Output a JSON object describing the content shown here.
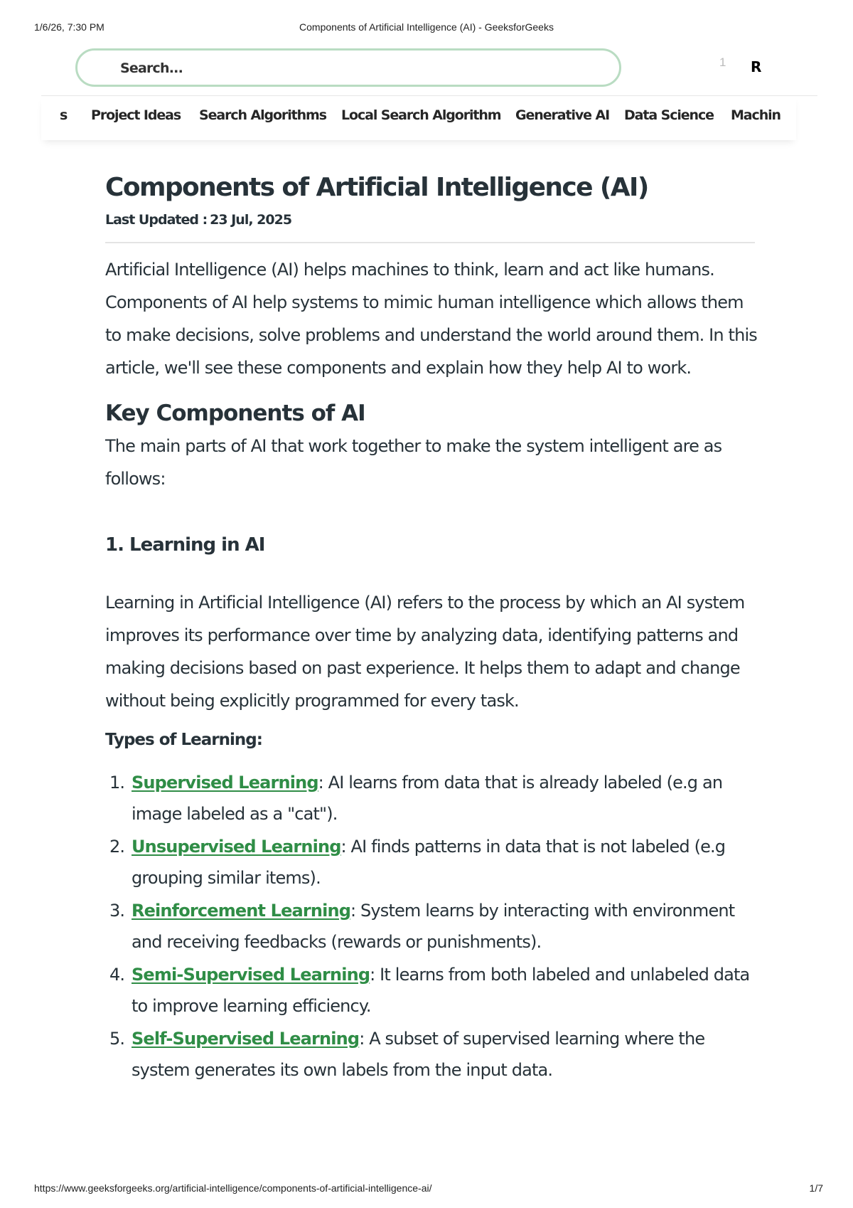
{
  "print_header": {
    "datetime": "1/6/26, 7:30 PM",
    "page_title": "Components of Artificial Intelligence (AI) - GeeksforGeeks"
  },
  "topbar": {
    "search_placeholder": "Search...",
    "notification_count": "1",
    "avatar_initial": "R"
  },
  "nav": {
    "items": [
      {
        "label": "s"
      },
      {
        "label": "Project Ideas"
      },
      {
        "label": "Search Algorithms"
      },
      {
        "label": "Local Search Algorithm"
      },
      {
        "label": "Generative AI"
      },
      {
        "label": "Data Science"
      },
      {
        "label": "Machin"
      }
    ]
  },
  "article": {
    "title": "Components of Artificial Intelligence (AI)",
    "last_updated_label": "Last Updated :",
    "last_updated_date": "23 Jul, 2025",
    "intro": "Artificial Intelligence (AI) helps machines to think, learn and act like humans. Components of AI help systems to mimic human intelligence which allows them to make decisions, solve problems and understand the world around them. In this article, we'll see these components and explain how they help AI to work.",
    "key_heading": "Key Components of AI",
    "key_desc": "The main parts of AI that work together to make the system intelligent are as follows:",
    "learning_heading": "1. Learning in AI",
    "learning_para": "Learning in Artificial Intelligence (AI) refers to the process by which an AI system improves its performance over time by analyzing data, identifying patterns and making decisions based on past experience. It helps them to adapt and change without being explicitly programmed for every task.",
    "types_heading": "Types of Learning:",
    "types": [
      {
        "num": "1.",
        "link": "Supervised Learning",
        "text": ": AI learns from data that is already labeled (e.g an image labeled as a \"cat\")."
      },
      {
        "num": "2.",
        "link": "Unsupervised Learning",
        "text": ": AI finds patterns in data that is not labeled (e.g grouping similar items)."
      },
      {
        "num": "3.",
        "link": "Reinforcement Learning",
        "text": ": System learns by interacting with environment and receiving feedbacks (rewards or punishments)."
      },
      {
        "num": "4.",
        "link": "Semi-Supervised Learning",
        "text": ": It learns from both labeled and unlabeled data to improve learning efficiency."
      },
      {
        "num": "5.",
        "link": "Self-Supervised Learning",
        "text": ": A subset of supervised learning where the system generates its own labels from the input data."
      }
    ]
  },
  "print_footer": {
    "url": "https://www.geeksforgeeks.org/artificial-intelligence/components-of-artificial-intelligence-ai/",
    "page_indicator": "1/7"
  },
  "colors": {
    "link_green": "#2f8d46",
    "search_border": "#b9dcc2",
    "text": "#273239"
  }
}
